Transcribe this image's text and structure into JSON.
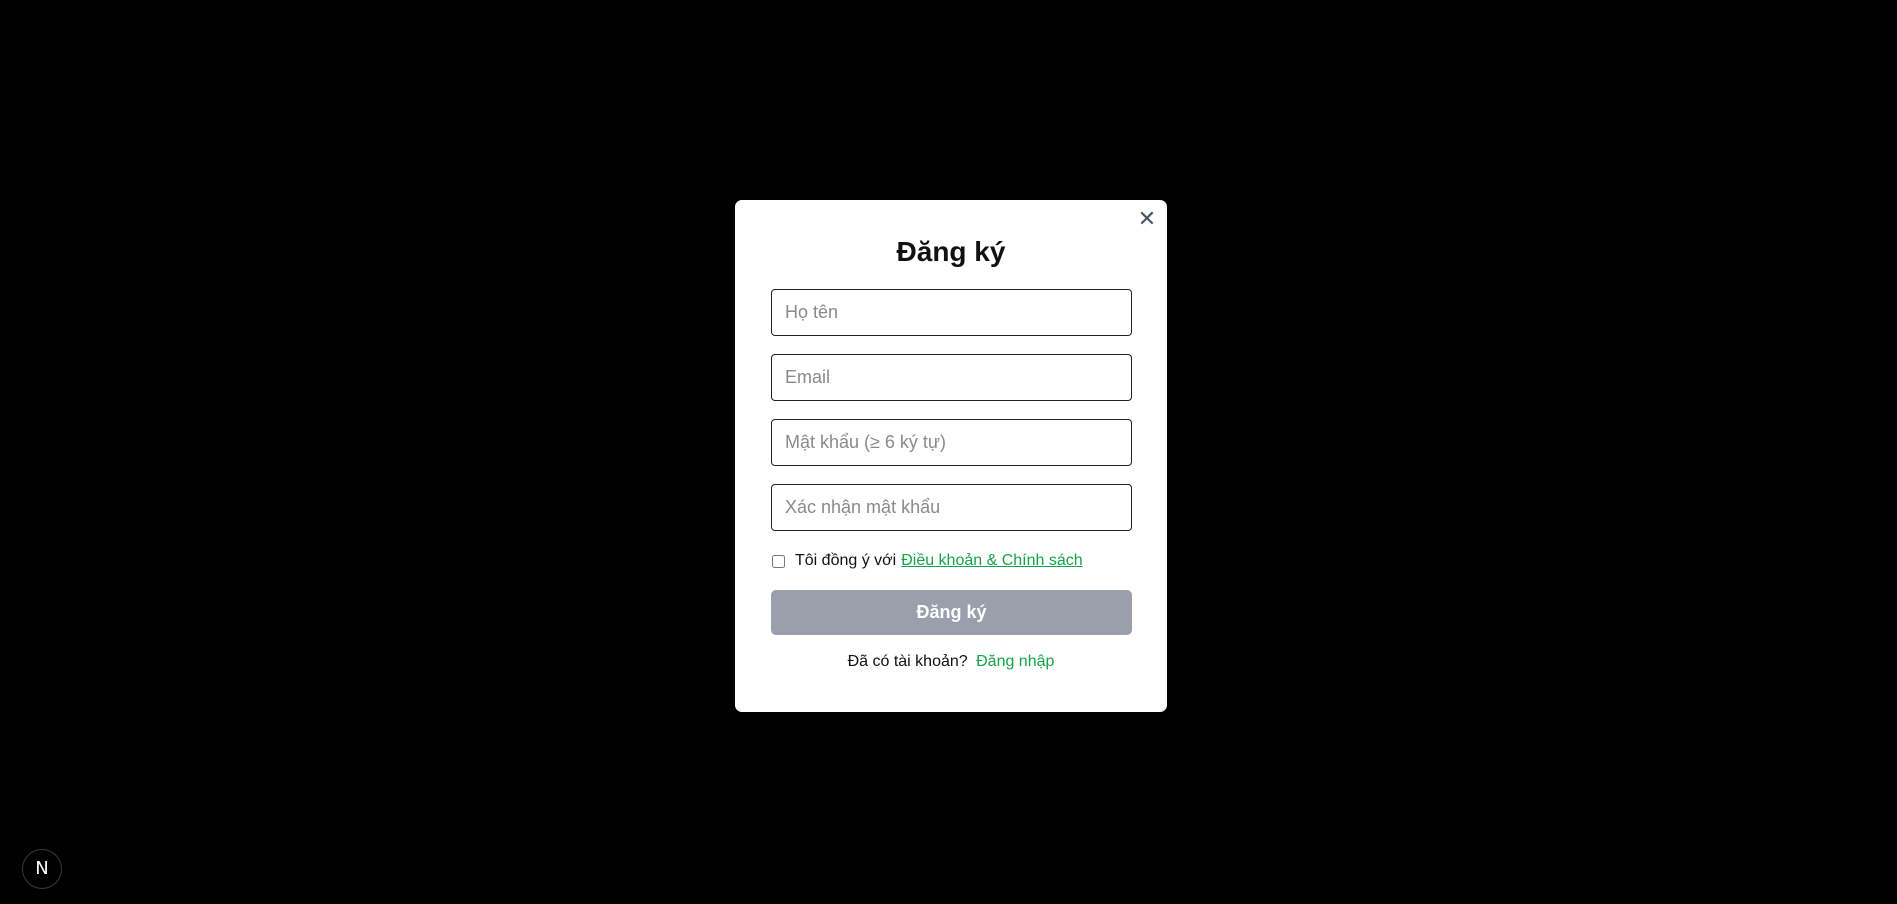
{
  "modal": {
    "title": "Đăng ký",
    "close_label": "✕",
    "fields": {
      "full_name_placeholder": "Họ tên",
      "email_placeholder": "Email",
      "password_placeholder": "Mật khẩu (≥ 6 ký tự)",
      "confirm_password_placeholder": "Xác nhận mật khẩu"
    },
    "agree": {
      "text": "Tôi đồng ý với",
      "link": "Điều khoản & Chính sách",
      "checked": false
    },
    "submit_label": "Đăng ký",
    "login_prompt": "Đã có tài khoản?",
    "login_link": "Đăng nhập"
  },
  "dev_badge": {
    "label": "N"
  },
  "colors": {
    "background": "#000000",
    "accent": "#16a34a",
    "submit_disabled": "#9aa0ab"
  }
}
